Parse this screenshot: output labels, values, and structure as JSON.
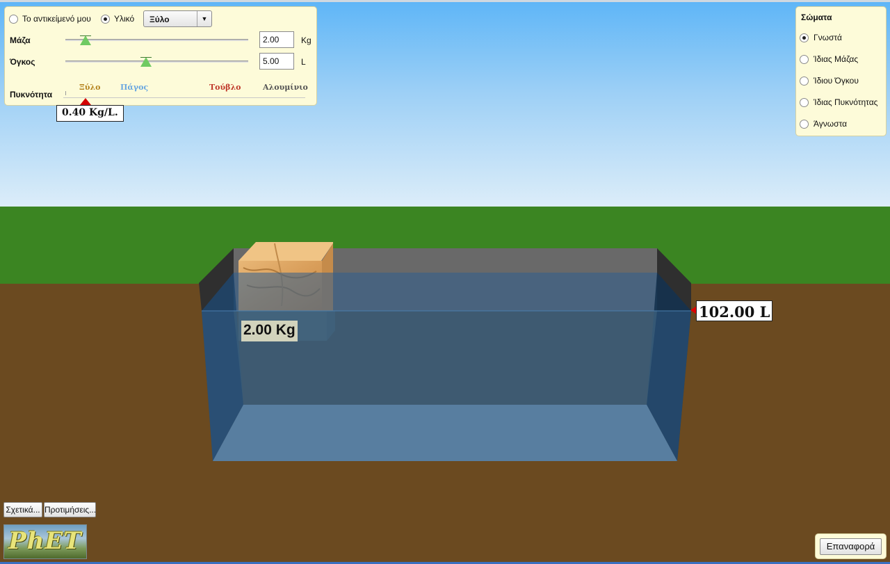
{
  "colors": {
    "sky_top": "#5fb6f7",
    "grass": "#3b8522",
    "ground": "#6b4a20",
    "water": "#2f5f8f",
    "panel_bg": "#fdfbd9",
    "slider_thumb": "#6fca62",
    "pointer_red": "#d40000"
  },
  "controls": {
    "radio_my_object": {
      "label": "Το αντικείμενό μου",
      "selected": false
    },
    "radio_material": {
      "label": "Υλικό",
      "selected": true
    },
    "material_dropdown": {
      "value": "Ξύλο"
    },
    "mass": {
      "label": "Μάζα",
      "value": "2.00",
      "unit": "Kg",
      "slider_fraction": 0.11
    },
    "volume": {
      "label": "Όγκος",
      "value": "5.00",
      "unit": "L",
      "slider_fraction": 0.44
    },
    "density": {
      "label": "Πυκνότητα",
      "materials": [
        {
          "name": "Ξύλο",
          "color": "#b5841f"
        },
        {
          "name": "Πάγος",
          "color": "#6aa7e0"
        },
        {
          "name": "Τούβλο",
          "color": "#c0392b"
        },
        {
          "name": "Αλουμίνιο",
          "color": "#555555"
        }
      ],
      "readout": "0.40 Kg/L."
    }
  },
  "bodies_panel": {
    "title": "Σώματα",
    "options": [
      {
        "label": "Γνωστά",
        "selected": true
      },
      {
        "label": "Ίδιας Μάζας",
        "selected": false
      },
      {
        "label": "Ίδιου Όγκου",
        "selected": false
      },
      {
        "label": "Ίδιας Πυκνότητας",
        "selected": false
      },
      {
        "label": "Άγνωστα",
        "selected": false
      }
    ]
  },
  "scene": {
    "block_mass_label": "2.00 Kg",
    "water_volume_readout": "102.00 L"
  },
  "bottom": {
    "about_button": "Σχετικά...",
    "preferences_button": "Προτιμήσεις...",
    "reset_button": "Επαναφορά",
    "logo_text": "PhET"
  }
}
